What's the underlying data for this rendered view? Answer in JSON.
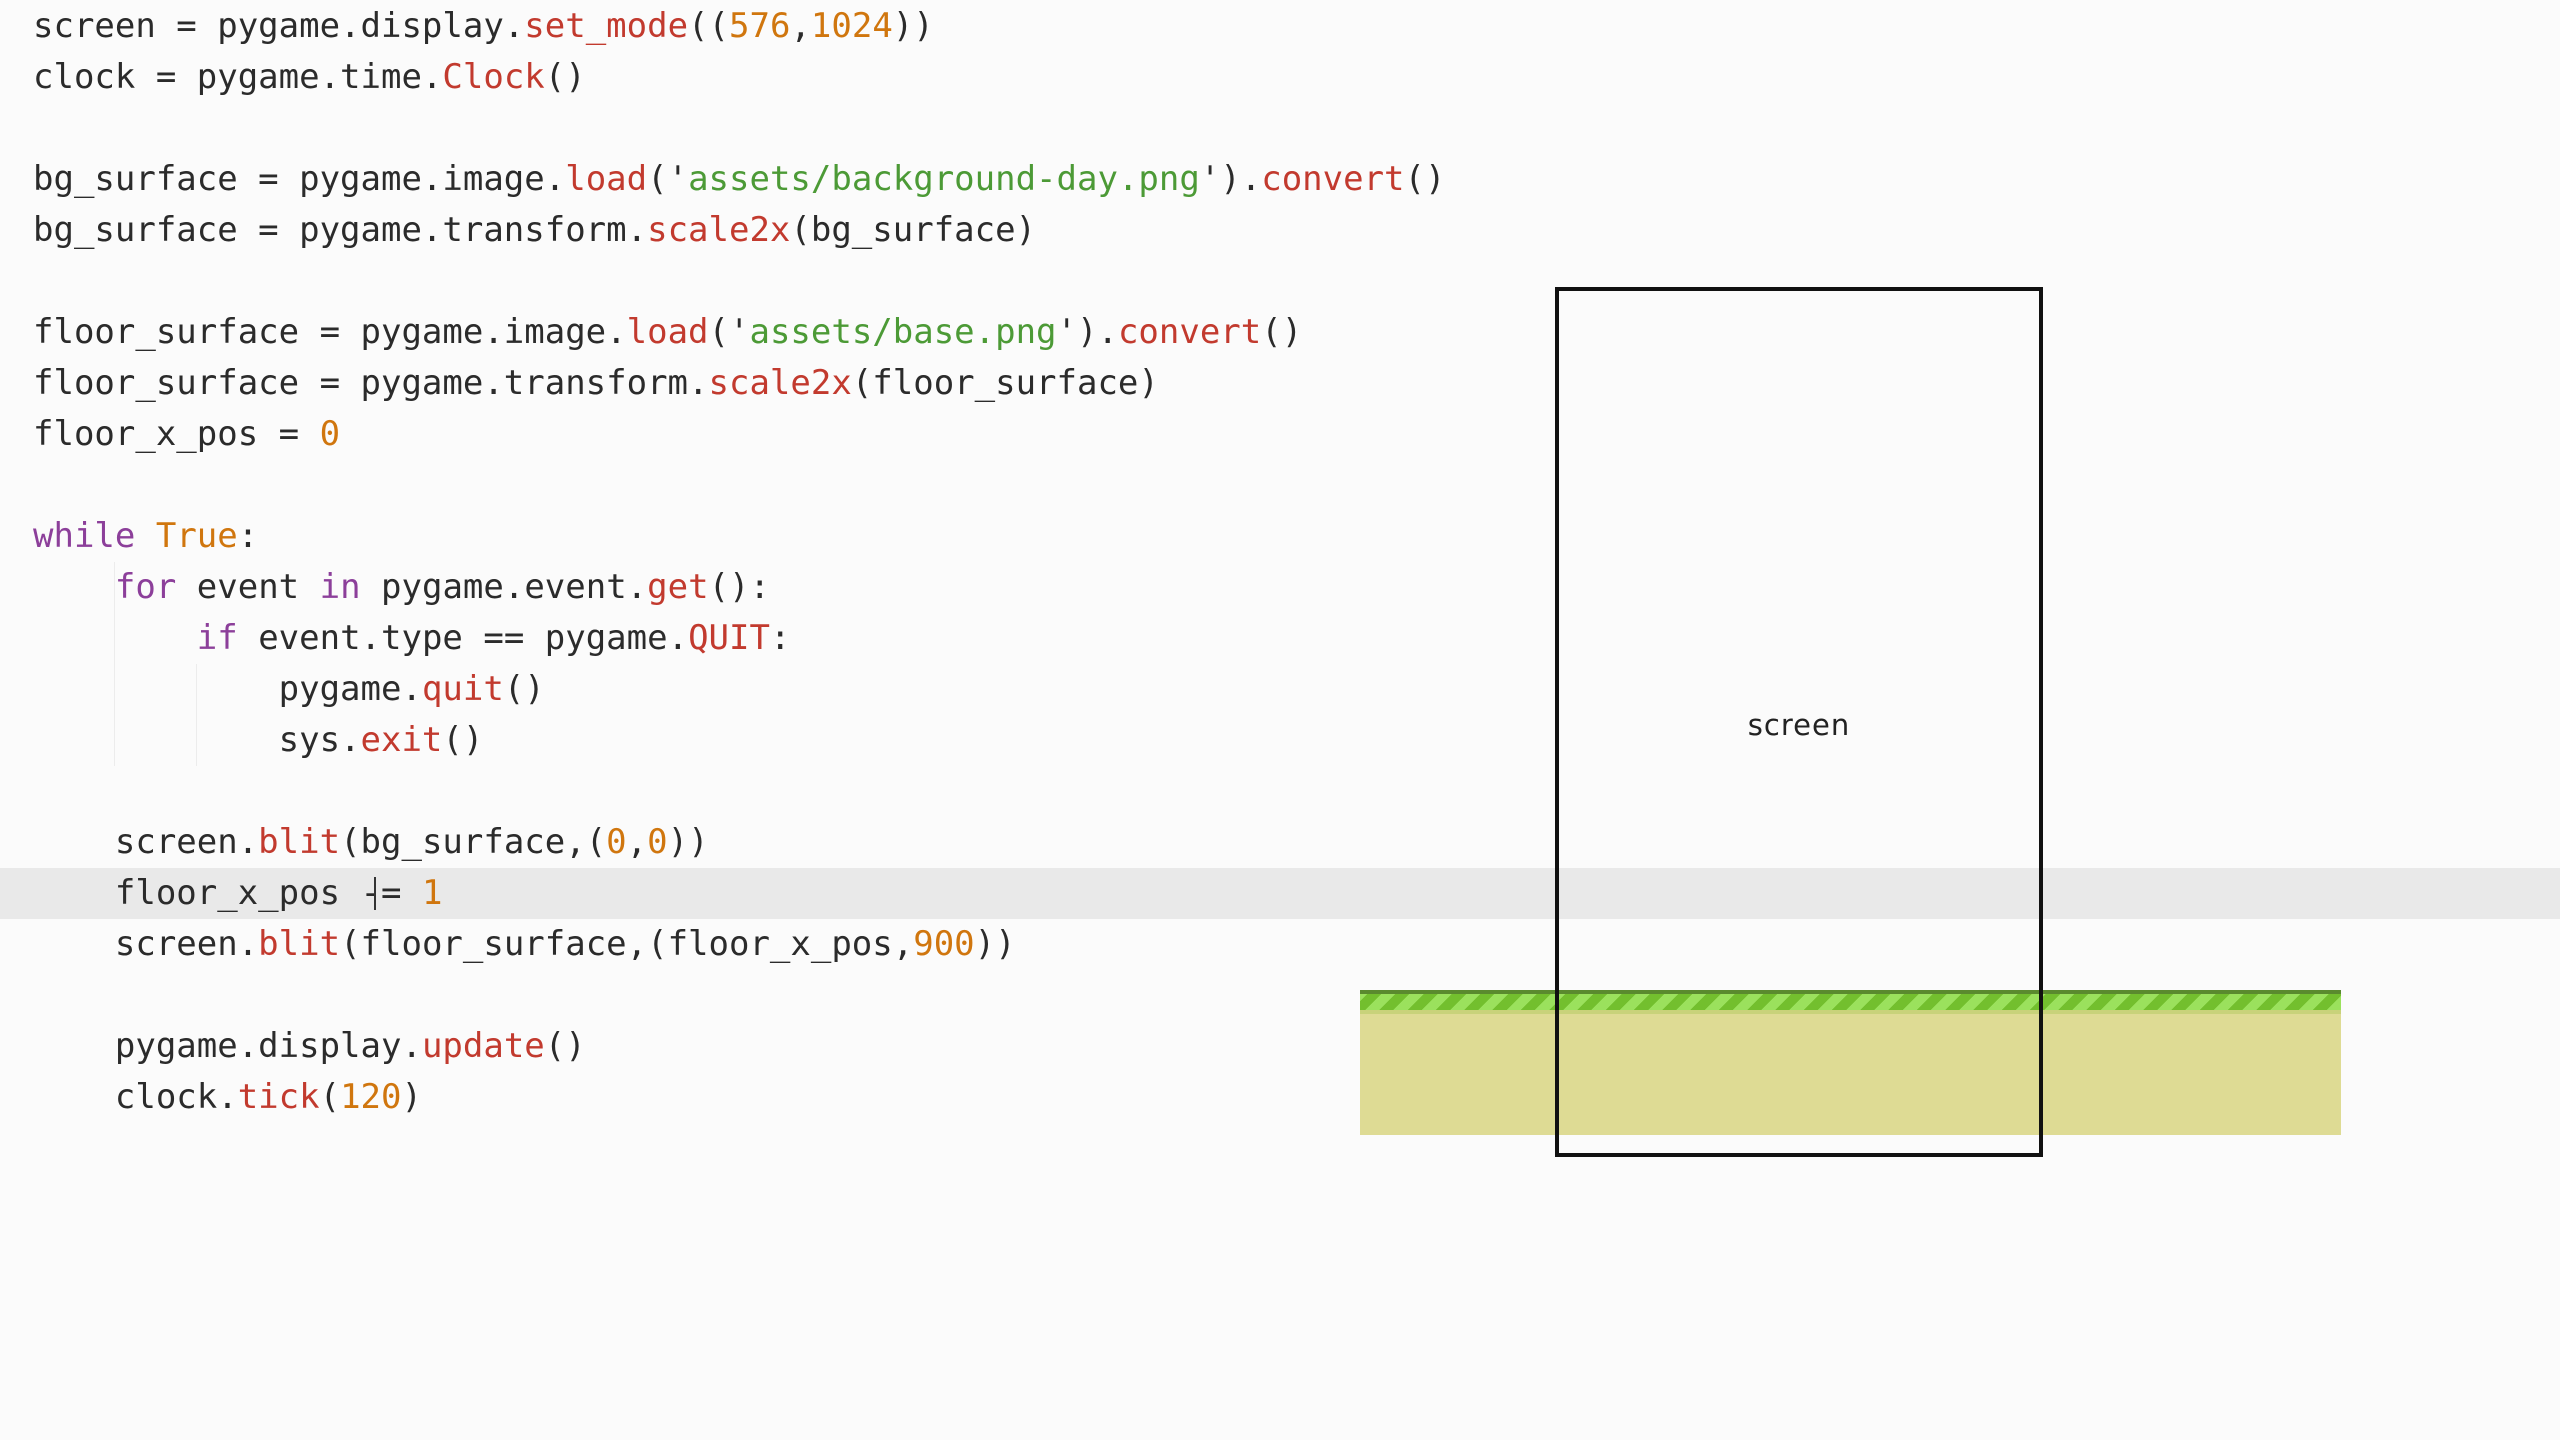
{
  "code": {
    "lines": [
      [
        [
          "screen = pygame.display.",
          "plain"
        ],
        [
          "set_mode",
          "fn"
        ],
        [
          "((",
          "plain"
        ],
        [
          "576",
          "num"
        ],
        [
          ",",
          "plain"
        ],
        [
          "1024",
          "num"
        ],
        [
          "))",
          "plain"
        ]
      ],
      [
        [
          "clock = pygame.time.",
          "plain"
        ],
        [
          "Clock",
          "fn"
        ],
        [
          "()",
          "plain"
        ]
      ],
      [],
      [
        [
          "bg_surface = pygame.image.",
          "plain"
        ],
        [
          "load",
          "fn"
        ],
        [
          "('",
          "plain"
        ],
        [
          "assets/background-day.png",
          "str"
        ],
        [
          "').",
          "plain"
        ],
        [
          "convert",
          "fn"
        ],
        [
          "()",
          "plain"
        ]
      ],
      [
        [
          "bg_surface = pygame.transform.",
          "plain"
        ],
        [
          "scale2x",
          "fn"
        ],
        [
          "(bg_surface)",
          "plain"
        ]
      ],
      [],
      [
        [
          "floor_surface = pygame.image.",
          "plain"
        ],
        [
          "load",
          "fn"
        ],
        [
          "('",
          "plain"
        ],
        [
          "assets/base.png",
          "str"
        ],
        [
          "').",
          "plain"
        ],
        [
          "convert",
          "fn"
        ],
        [
          "()",
          "plain"
        ]
      ],
      [
        [
          "floor_surface = pygame.transform.",
          "plain"
        ],
        [
          "scale2x",
          "fn"
        ],
        [
          "(floor_surface)",
          "plain"
        ]
      ],
      [
        [
          "floor_x_pos = ",
          "plain"
        ],
        [
          "0",
          "num"
        ]
      ],
      [],
      [
        [
          "while",
          "kw"
        ],
        [
          " ",
          "plain"
        ],
        [
          "True",
          "const"
        ],
        [
          ":",
          "plain"
        ]
      ],
      [
        [
          "    ",
          "plain"
        ],
        [
          "for",
          "kw"
        ],
        [
          " event ",
          "plain"
        ],
        [
          "in",
          "kw"
        ],
        [
          " pygame.event.",
          "plain"
        ],
        [
          "get",
          "fn"
        ],
        [
          "():",
          "plain"
        ]
      ],
      [
        [
          "        ",
          "plain"
        ],
        [
          "if",
          "kw"
        ],
        [
          " event.type == pygame.",
          "plain"
        ],
        [
          "QUIT",
          "fn"
        ],
        [
          ":",
          "plain"
        ]
      ],
      [
        [
          "            pygame.",
          "plain"
        ],
        [
          "quit",
          "fn"
        ],
        [
          "()",
          "plain"
        ]
      ],
      [
        [
          "            sys.",
          "plain"
        ],
        [
          "exit",
          "fn"
        ],
        [
          "()",
          "plain"
        ]
      ],
      [],
      [
        [
          "    screen.",
          "plain"
        ],
        [
          "blit",
          "fn"
        ],
        [
          "(bg_surface,(",
          "plain"
        ],
        [
          "0",
          "num"
        ],
        [
          ",",
          "plain"
        ],
        [
          "0",
          "num"
        ],
        [
          "))",
          "plain"
        ]
      ],
      [
        [
          "    floor_x_pos -= ",
          "plain"
        ],
        [
          "1",
          "num"
        ]
      ],
      [
        [
          "    screen.",
          "plain"
        ],
        [
          "blit",
          "fn"
        ],
        [
          "(floor_surface,(floor_x_pos,",
          "plain"
        ],
        [
          "900",
          "num"
        ],
        [
          "))",
          "plain"
        ]
      ],
      [],
      [
        [
          "    pygame.display.",
          "plain"
        ],
        [
          "update",
          "fn"
        ],
        [
          "()",
          "plain"
        ]
      ],
      [
        [
          "    clock.",
          "plain"
        ],
        [
          "tick",
          "fn"
        ],
        [
          "(",
          "plain"
        ],
        [
          "120",
          "num"
        ],
        [
          ")",
          "plain"
        ]
      ]
    ],
    "active_line": 17
  },
  "diagram": {
    "screen_label": "screen"
  },
  "colors": {
    "keyword": "#8c3f9a",
    "function": "#c23a2e",
    "number": "#d0760e",
    "string": "#4c9a36",
    "floor": "#dedb94",
    "grass_light": "#9be15d",
    "grass_dark": "#73bf2e"
  }
}
